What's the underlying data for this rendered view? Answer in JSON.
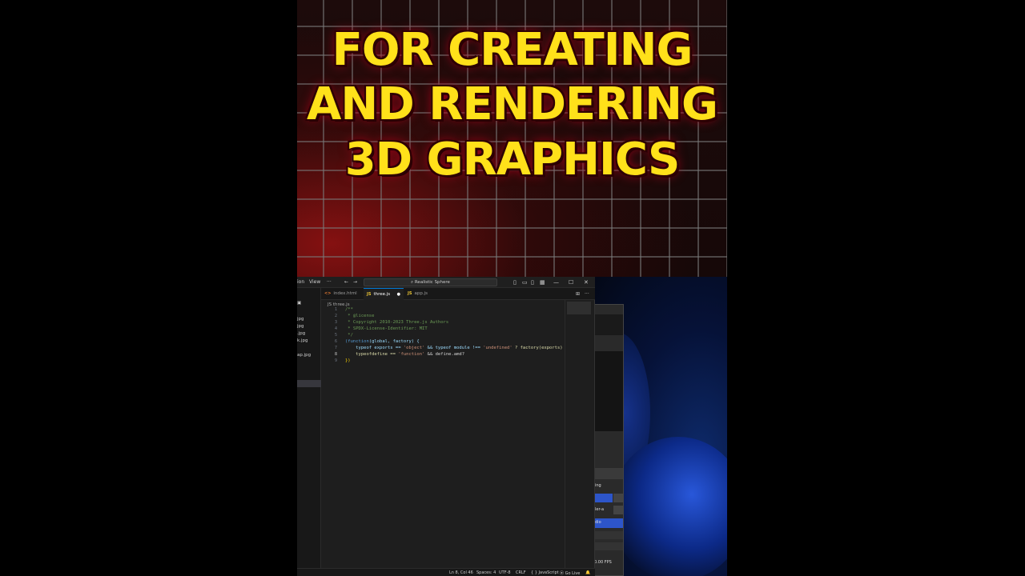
{
  "headline": {
    "line1": "FOR CREATING",
    "line2": "AND RENDERING",
    "line3": "3D GRAPHICS"
  },
  "titlebar": {
    "menu_partial": "ion",
    "menu_view": "View",
    "menu_more": "···",
    "back": "←",
    "forward": "→",
    "search_text": "⌕ Realistic Sphere",
    "min": "—",
    "max": "☐",
    "close": "✕"
  },
  "sidebar": {
    "header": "▣",
    "files": [
      "jpg",
      "jpg",
      ".jpg",
      "k.jpg",
      "",
      "ap.jpg"
    ]
  },
  "tabs": [
    {
      "icon": "<>",
      "label": "index.html"
    },
    {
      "icon": "JS",
      "label": "three.js"
    },
    {
      "icon": "JS",
      "label": "app.js"
    }
  ],
  "tab_dirty": "●",
  "tabs_more": "···",
  "breadcrumb": "JS three.js",
  "code": {
    "line_numbers": [
      "1",
      "2",
      "3",
      "4",
      "5",
      "6",
      "7",
      "8",
      "9"
    ],
    "l1": "/**",
    "l2": " * @license",
    "l3": " * Copyright 2010-2023 Three.js Authors",
    "l4": " * SPDX-License-Identifier: MIT",
    "l5": " */",
    "l6a": "(function",
    "l6b": "(global, factory) {",
    "l7a": "    typeof exports == ",
    "l7b": "'object'",
    "l7c": " && typeof module !== ",
    "l7d": "'undefined'",
    "l7e": " ? factory(exports) :",
    "l8a": "    typeofdefine == ",
    "l8b": "'function'",
    "l8c": " && define.amd?",
    "l9": "})"
  },
  "statusbar": {
    "position": "Ln 8, Col 46",
    "spaces": "Spaces: 4",
    "encoding": "UTF-8",
    "eol": "CRLF",
    "language": "{ } JavaScript",
    "golive": "⦿ Go Live",
    "bell": "🔔"
  },
  "preview": {
    "label1": "ing",
    "label2": "ler-a",
    "label3": "dio",
    "fps": "0.00 FPS"
  }
}
